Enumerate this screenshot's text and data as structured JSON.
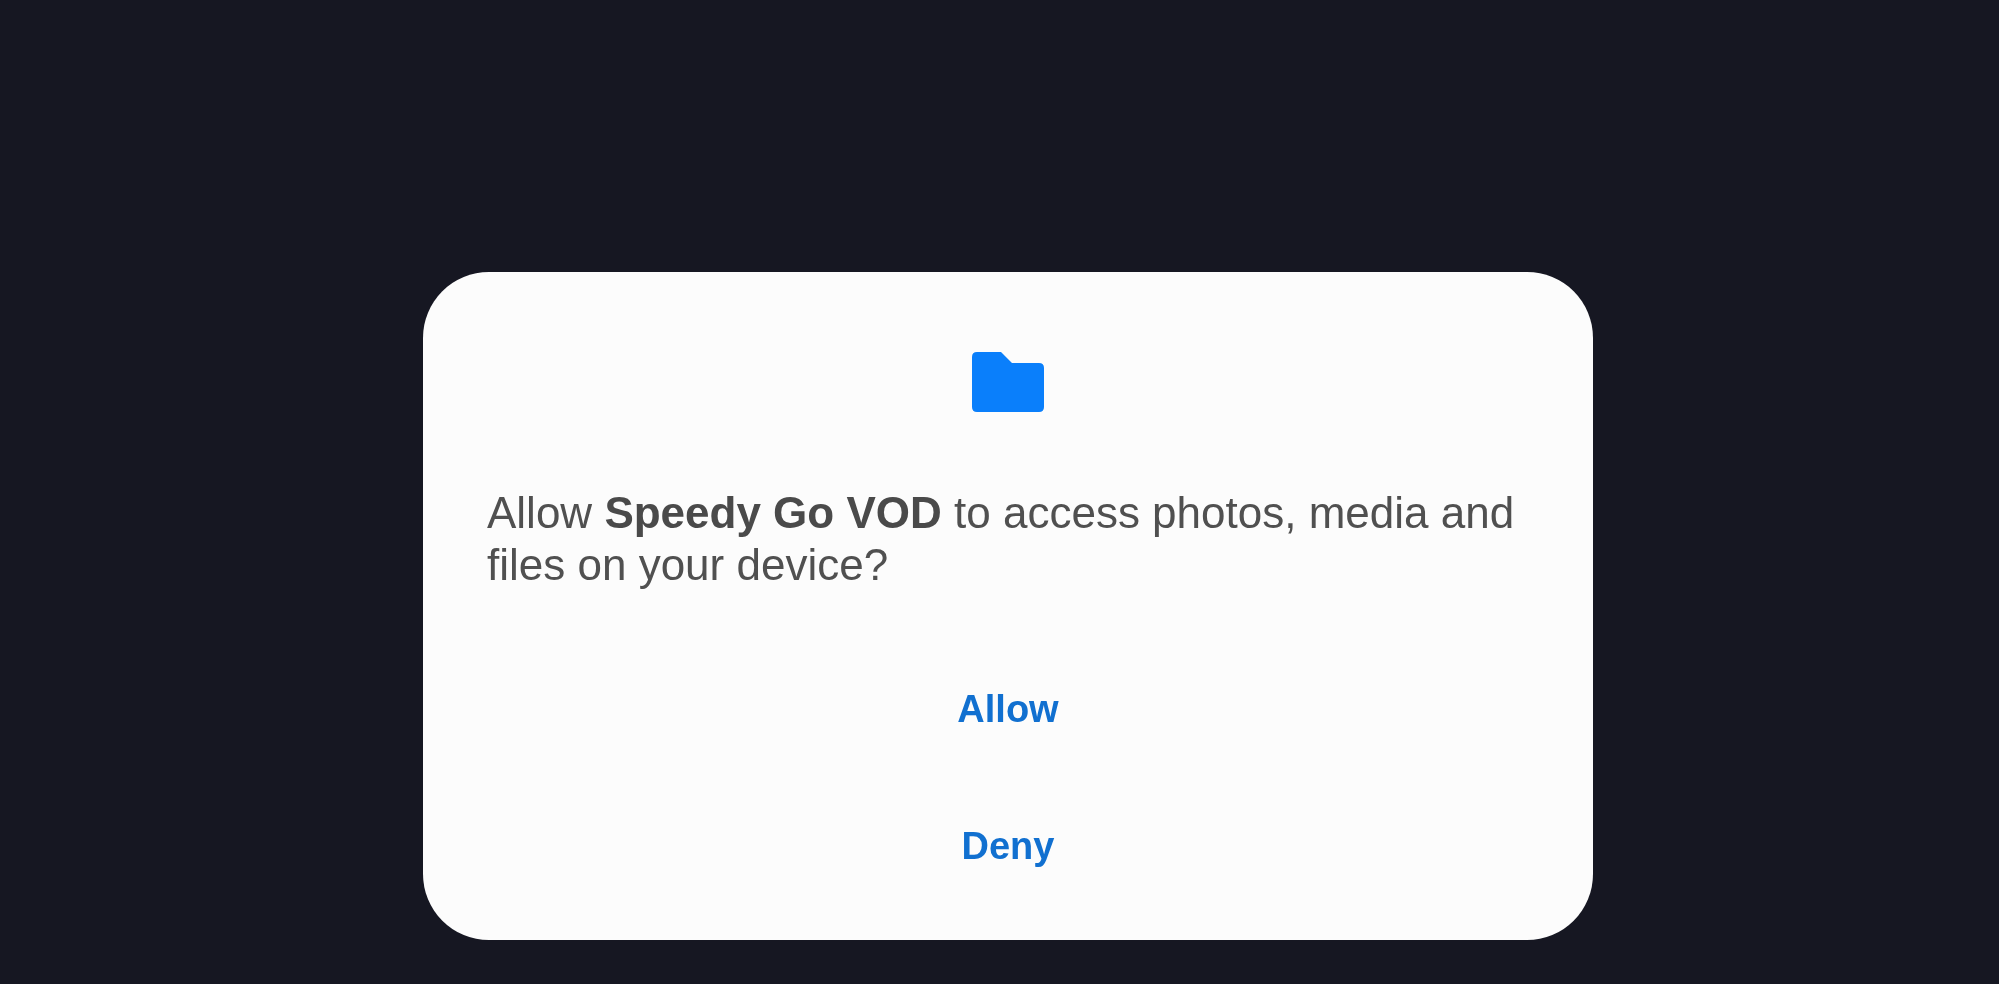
{
  "dialog": {
    "message": "Allow **Speedy Go VOD** to access photos, media and files on your device?",
    "buttons": [
      {
        "label": "Allow"
      },
      {
        "label": "Deny"
      }
    ]
  }
}
